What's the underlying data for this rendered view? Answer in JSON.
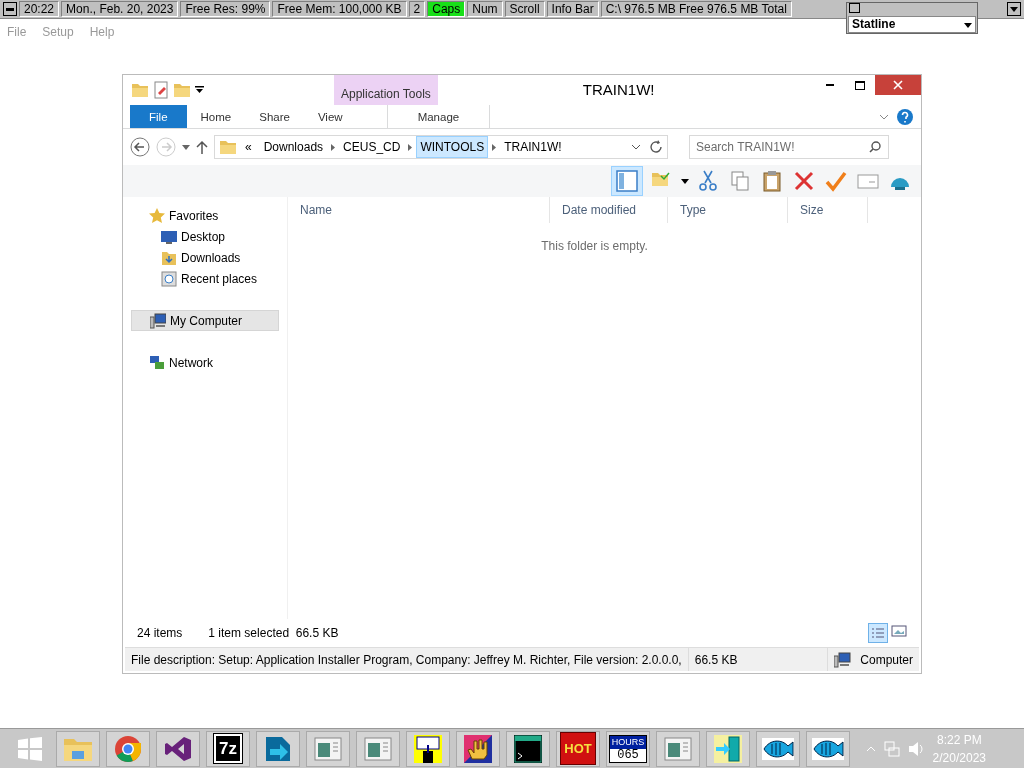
{
  "info_bar": {
    "items": [
      {
        "text": "20:22",
        "on": false
      },
      {
        "text": "Mon., Feb. 20, 2023",
        "on": false
      },
      {
        "text": "Free Res: 99%",
        "on": false
      },
      {
        "text": "Free Mem: 100,000 KB",
        "on": false
      },
      {
        "text": "2",
        "on": false
      },
      {
        "text": "Caps",
        "on": true
      },
      {
        "text": "Num",
        "on": false
      },
      {
        "text": "Scroll",
        "on": false
      },
      {
        "text": "Info Bar",
        "on": false
      },
      {
        "text": "C:\\ 976.5 MB Free  976.5 MB Total",
        "on": false
      }
    ],
    "statline": {
      "value": "Statline"
    }
  },
  "menu": [
    "File",
    "Setup",
    "Help"
  ],
  "window": {
    "title": "TRAIN1W!",
    "context_group": "Application Tools",
    "tabs": [
      {
        "label": "File",
        "kind": "file",
        "selected": false
      },
      {
        "label": "Home",
        "kind": "tab",
        "selected": false
      },
      {
        "label": "Share",
        "kind": "tab",
        "selected": false
      },
      {
        "label": "View",
        "kind": "tab",
        "selected": false
      },
      {
        "label": "Manage",
        "kind": "context",
        "selected": false
      }
    ],
    "address": {
      "overflow": "«",
      "crumbs": [
        {
          "label": "Downloads",
          "selected": false
        },
        {
          "label": "CEUS_CD",
          "selected": false
        },
        {
          "label": "WINTOOLS",
          "selected": true
        },
        {
          "label": "TRAIN1W!",
          "selected": false
        }
      ]
    },
    "search": {
      "placeholder": "Search TRAIN1W!"
    },
    "nav": [
      {
        "label": "Favorites",
        "kind": "star",
        "selected": false,
        "children": [
          {
            "label": "Desktop",
            "kind": "desktop",
            "selected": false
          },
          {
            "label": "Downloads",
            "kind": "folder",
            "selected": false
          },
          {
            "label": "Recent places",
            "kind": "recent",
            "selected": false
          }
        ]
      },
      {
        "label": "My Computer",
        "kind": "computer",
        "selected": true
      },
      {
        "label": "Network",
        "kind": "network",
        "selected": false
      }
    ],
    "columns": [
      "Name",
      "Date modified",
      "Type",
      "Size"
    ],
    "empty_message": "This folder is empty.",
    "status": {
      "count": "24 items",
      "selection": "1 item selected  66.5 KB"
    },
    "details_bar": {
      "description": "File description: Setup: Application Installer Program, Company: Jeffrey M. Richter, File version: 2.0.0.0,",
      "size": "66.5 KB",
      "location": "Computer"
    }
  },
  "taskbar": {
    "items": [
      {
        "kind": "start"
      },
      {
        "kind": "folder"
      },
      {
        "kind": "chrome"
      },
      {
        "kind": "vs"
      },
      {
        "kind": "sevenzip",
        "text": "7z"
      },
      {
        "kind": "arrow"
      },
      {
        "kind": "window"
      },
      {
        "kind": "window"
      },
      {
        "kind": "floppy"
      },
      {
        "kind": "hand"
      },
      {
        "kind": "console"
      },
      {
        "kind": "hot",
        "text": "HOT"
      },
      {
        "kind": "hours",
        "text": "HOURS",
        "reading": "065"
      },
      {
        "kind": "window"
      },
      {
        "kind": "door"
      },
      {
        "kind": "fish"
      },
      {
        "kind": "fish"
      }
    ],
    "time": "8:22 PM",
    "date": "2/20/2023"
  }
}
